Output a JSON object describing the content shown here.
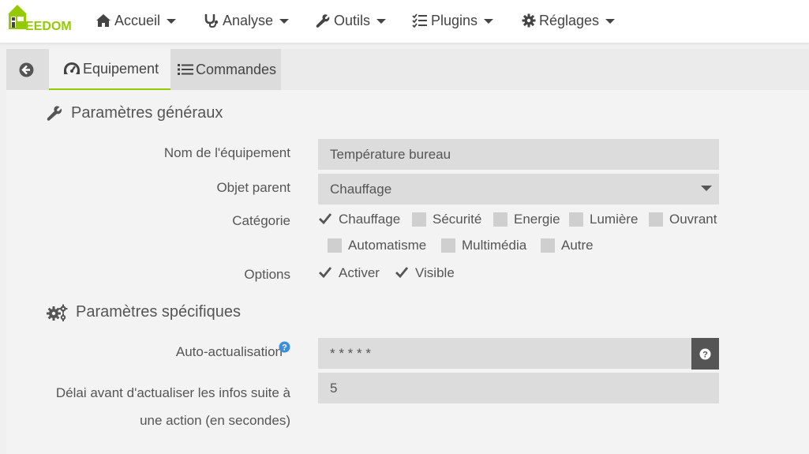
{
  "app": {
    "logo_text": "EEDOM"
  },
  "nav": {
    "items": [
      {
        "label": "Accueil",
        "icon": "home-icon"
      },
      {
        "label": "Analyse",
        "icon": "stethoscope-icon"
      },
      {
        "label": "Outils",
        "icon": "wrench-icon"
      },
      {
        "label": "Plugins",
        "icon": "tasks-icon"
      },
      {
        "label": "Réglages",
        "icon": "cog-icon"
      }
    ]
  },
  "tabs": {
    "back_icon": "arrow-circle-left-icon",
    "items": [
      {
        "label": "Equipement",
        "icon": "tachometer-icon",
        "active": true
      },
      {
        "label": "Commandes",
        "icon": "list-icon",
        "active": false
      }
    ]
  },
  "general": {
    "title": "Paramètres généraux",
    "name_label": "Nom de l'équipement",
    "name_value": "Température bureau",
    "parent_label": "Objet parent",
    "parent_value": "Chauffage",
    "category_label": "Catégorie",
    "categories": [
      {
        "label": "Chauffage",
        "checked": true
      },
      {
        "label": "Sécurité",
        "checked": false
      },
      {
        "label": "Energie",
        "checked": false
      },
      {
        "label": "Lumière",
        "checked": false
      },
      {
        "label": "Ouvrant",
        "checked": false
      },
      {
        "label": "Automatisme",
        "checked": false
      },
      {
        "label": "Multimédia",
        "checked": false
      },
      {
        "label": "Autre",
        "checked": false
      }
    ],
    "options_label": "Options",
    "options": [
      {
        "label": "Activer",
        "checked": true
      },
      {
        "label": "Visible",
        "checked": true
      }
    ]
  },
  "specific": {
    "title": "Paramètres spécifiques",
    "autorefresh_label": "Auto-actualisation",
    "autorefresh_value": "* * * * *",
    "delay_label_line1": "Délai avant d'actualiser les infos suite à",
    "delay_label_line2": "une action (en secondes)",
    "delay_value": "5"
  },
  "colors": {
    "accent": "#94ca02",
    "input_bg": "#dcdcdc",
    "help_button_bg": "#555555",
    "info_blue": "#3b8ede"
  }
}
